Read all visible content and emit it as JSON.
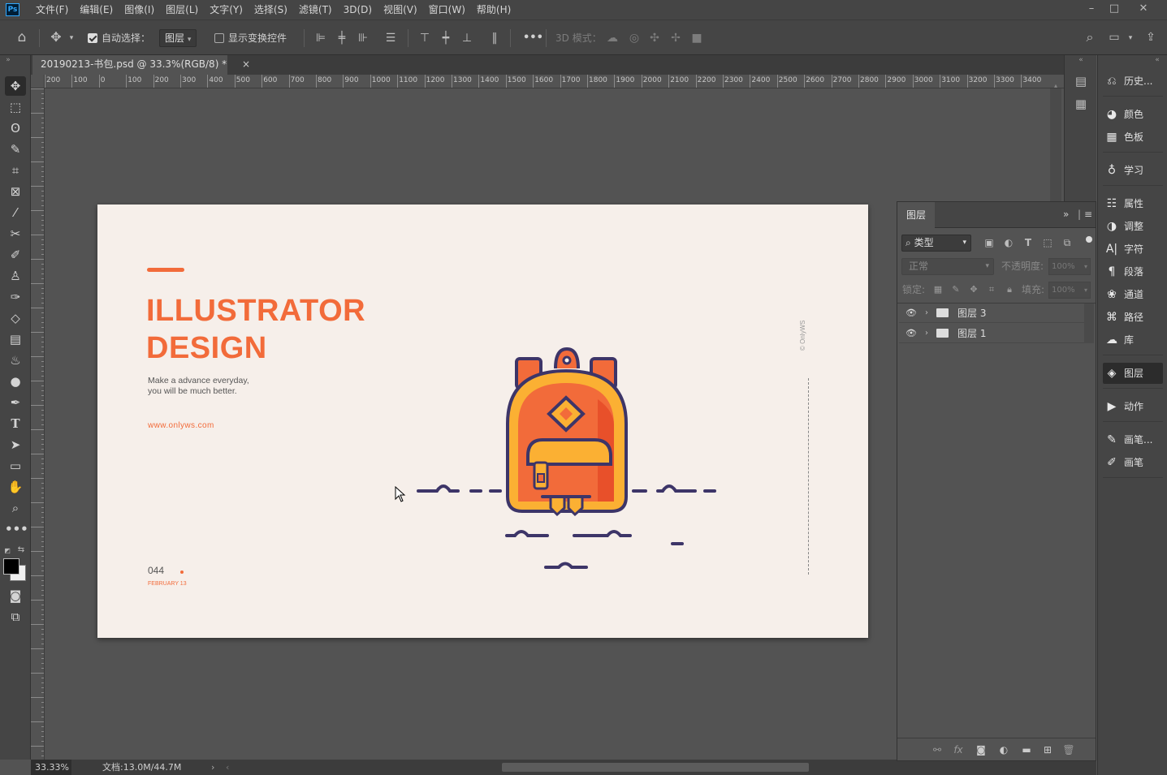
{
  "app": {
    "logo": "Ps",
    "menu": [
      "文件(F)",
      "编辑(E)",
      "图像(I)",
      "图层(L)",
      "文字(Y)",
      "选择(S)",
      "滤镜(T)",
      "3D(D)",
      "视图(V)",
      "窗口(W)",
      "帮助(H)"
    ]
  },
  "options": {
    "auto_select_label": "自动选择：",
    "auto_select_value": "图层",
    "show_transform_label": "显示变换控件",
    "mode_3d_label": "3D 模式：",
    "more_label": "•••"
  },
  "document": {
    "tab_title": "20190213-书包.psd @ 33.3%(RGB/8) *",
    "close_glyph": "×"
  },
  "ruler_h": [
    "200",
    "100",
    "0",
    "100",
    "200",
    "300",
    "400",
    "500",
    "600",
    "700",
    "800",
    "900",
    "1000",
    "1100",
    "1200",
    "1300",
    "1400",
    "1500",
    "1600",
    "1700",
    "1800",
    "1900",
    "2000",
    "2100",
    "2200",
    "2300",
    "2400",
    "2500",
    "2600",
    "2700",
    "2800",
    "2900",
    "3000",
    "3100",
    "3200",
    "3300",
    "3400"
  ],
  "artboard": {
    "title_line1": "ILLUSTRATOR",
    "title_line2": "DESIGN",
    "tagline_line1": "Make a advance everyday,",
    "tagline_line2": "you will be much better.",
    "url": "www.onlyws.com",
    "page_number": "044",
    "date": "FEBRUARY 13",
    "watermark": "© OnlyWS",
    "accent_color": "#f26b3a",
    "dark_color": "#3d3568"
  },
  "status": {
    "zoom": "33.33%",
    "doc_info": "文档:13.0M/44.7M"
  },
  "layers_panel": {
    "tab": "图层",
    "filter_kind": "类型",
    "blend_mode": "正常",
    "opacity_label": "不透明度:",
    "opacity_value": "100%",
    "lock_label": "锁定:",
    "fill_label": "填充:",
    "fill_value": "100%",
    "layers": [
      {
        "name": "图层 3",
        "visible": true
      },
      {
        "name": "图层 1",
        "visible": true
      }
    ]
  },
  "right_dock": {
    "items": [
      {
        "icon": "history-icon",
        "label": "历史..."
      },
      {
        "icon": "color-icon",
        "label": "颜色"
      },
      {
        "icon": "swatches-icon",
        "label": "色板"
      },
      {
        "icon": "learn-icon",
        "label": "学习"
      },
      {
        "icon": "properties-icon",
        "label": "属性"
      },
      {
        "icon": "adjustments-icon",
        "label": "调整"
      },
      {
        "icon": "character-icon",
        "label": "字符"
      },
      {
        "icon": "paragraph-icon",
        "label": "段落"
      },
      {
        "icon": "channels-icon",
        "label": "通道"
      },
      {
        "icon": "paths-icon",
        "label": "路径"
      },
      {
        "icon": "libraries-icon",
        "label": "库"
      },
      {
        "icon": "layers-icon",
        "label": "图层"
      },
      {
        "icon": "actions-icon",
        "label": "动作"
      },
      {
        "icon": "brush-settings-icon",
        "label": "画笔..."
      },
      {
        "icon": "brushes-icon",
        "label": "画笔"
      }
    ]
  }
}
